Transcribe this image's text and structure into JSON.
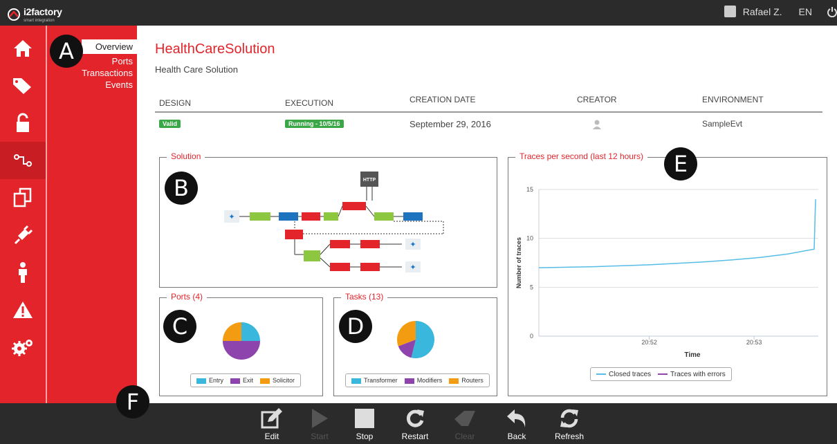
{
  "app": {
    "logo_text": "i2factory",
    "logo_sub": "smart integration",
    "user_name": "Rafael Z.",
    "language": "EN"
  },
  "sidebar_icons": [
    "home-icon",
    "tags-icon",
    "unlock-icon",
    "integration-icon",
    "copy-icon",
    "plug-icon",
    "user-icon",
    "warning-icon",
    "settings-icon"
  ],
  "subnav": {
    "items": [
      "Overview",
      "Ports",
      "Transactions",
      "Events"
    ]
  },
  "markers": [
    "A",
    "B",
    "C",
    "D",
    "E",
    "F"
  ],
  "solution": {
    "title": "HealthCareSolution",
    "subtitle": "Health Care Solution",
    "headers": [
      "DESIGN",
      "EXECUTION",
      "CREATION DATE",
      "CREATOR",
      "ENVIRONMENT"
    ],
    "design_status": "Valid",
    "execution_status": "Running - 10/5/16",
    "creation_date": "September 29, 2016",
    "environment": "SampleEvt"
  },
  "panels": {
    "solution": "Solution",
    "ports": "Ports (4)",
    "tasks": "Tasks (13)",
    "traces": "Traces per second (last 12 hours)"
  },
  "diagram": {
    "http_label": "HTTP"
  },
  "colors": {
    "accent": "#e3242b",
    "entry": "#3ab7dc",
    "exit": "#8e44ad",
    "solicitor": "#f39c12",
    "valid": "#3aa746",
    "closed_traces": "#56bde8",
    "traces_errors": "#8e44ad"
  },
  "chart_data": [
    {
      "type": "pie",
      "title": "Ports (4)",
      "categories": [
        "Entry",
        "Exit",
        "Solicitor"
      ],
      "values": [
        1,
        2,
        1
      ]
    },
    {
      "type": "pie",
      "title": "Tasks (13)",
      "categories": [
        "Transformer",
        "Modifiers",
        "Routers"
      ],
      "values": [
        7,
        2,
        4
      ]
    },
    {
      "type": "line",
      "title": "Traces per second (last 12 hours)",
      "xlabel": "Time",
      "ylabel": "Number of traces",
      "ylim": [
        0,
        15
      ],
      "yticks": [
        "0",
        "5",
        "10",
        "15"
      ],
      "xticks": [
        "20:52",
        "20:53"
      ],
      "grid": true,
      "legend_position": "bottom",
      "series": [
        {
          "name": "Closed traces",
          "x": [
            0,
            0.1,
            0.2,
            0.3,
            0.4,
            0.5,
            0.6,
            0.7,
            0.8,
            0.9,
            0.995,
            1.0
          ],
          "values": [
            7.0,
            7.05,
            7.1,
            7.2,
            7.3,
            7.45,
            7.6,
            7.8,
            8.05,
            8.4,
            8.9,
            14.0
          ]
        },
        {
          "name": "Traces with errors",
          "x": [],
          "values": []
        }
      ]
    }
  ],
  "toolbar": {
    "edit": "Edit",
    "start": "Start",
    "stop": "Stop",
    "restart": "Restart",
    "clear": "Clear",
    "back": "Back",
    "refresh": "Refresh"
  }
}
